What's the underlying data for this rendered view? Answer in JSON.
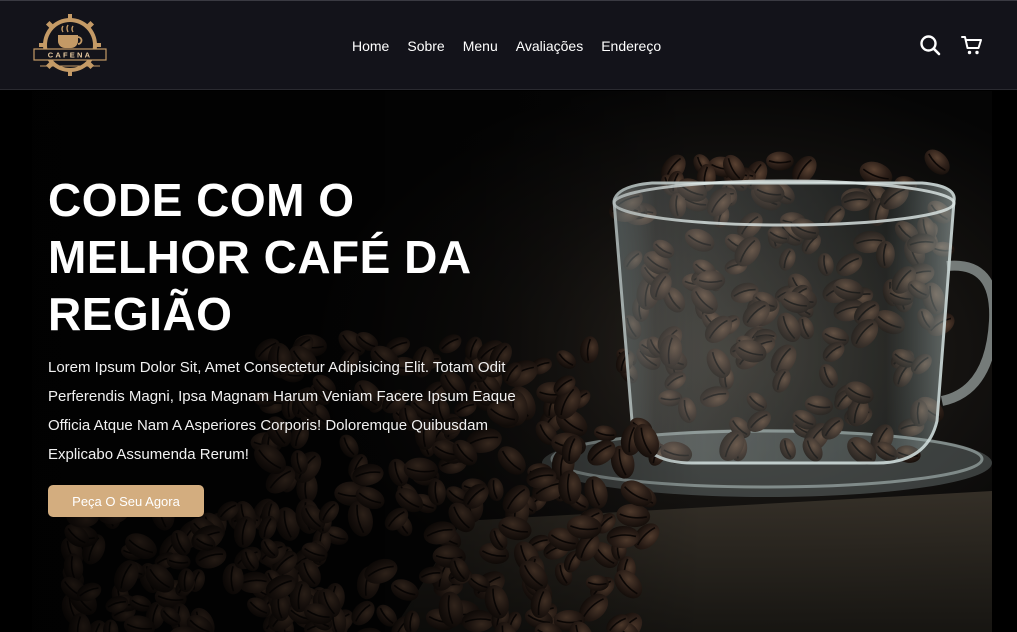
{
  "header": {
    "logo_text": "CAFENA",
    "nav": [
      "Home",
      "Sobre",
      "Menu",
      "Avaliações",
      "Endereço"
    ],
    "icons": [
      "search-icon",
      "cart-icon"
    ]
  },
  "hero": {
    "title": "CODE COM O MELHOR CAFÉ DA REGIÃO",
    "text": "Lorem Ipsum Dolor Sit, Amet Consectetur Adipisicing Elit. Totam Odit Perferendis Magni, Ipsa Magnam Harum Veniam Facere Ipsum Eaque Officia Atque Nam A Asperiores Corporis! Doloremque Quibusdam Explicabo Assumenda Rerum!",
    "cta_label": "Peça O Seu Agora"
  },
  "colors": {
    "header_bg": "#13131a",
    "accent": "#d3ad7f",
    "text": "#ffffff",
    "page_bg": "#000000"
  }
}
